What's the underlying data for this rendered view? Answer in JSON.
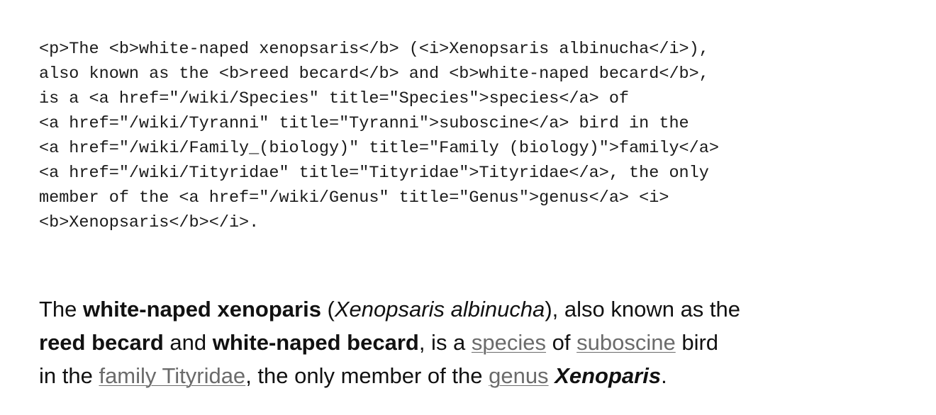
{
  "source_html": {
    "lines": [
      "<p>The <b>white-naped xenopsaris</b> (<i>Xenopsaris albinucha</i>),",
      "also known as the <b>reed becard</b> and <b>white-naped becard</b>,",
      "is a <a href=\"/wiki/Species\" title=\"Species\">species</a> of",
      "<a href=\"/wiki/Tyranni\" title=\"Tyranni\">suboscine</a> bird in the",
      "<a href=\"/wiki/Family_(biology)\" title=\"Family (biology)\">family</a>",
      "<a href=\"/wiki/Tityridae\" title=\"Tityridae\">Tityridae</a>, the only",
      "member of the <a href=\"/wiki/Genus\" title=\"Genus\">genus</a> <i>",
      "<b>Xenopsaris</b></i>."
    ]
  },
  "rendered": {
    "line1": {
      "t1": "The ",
      "b1": "white-naped xenoparis",
      "t2": " (",
      "i1": "Xenopsaris albinucha",
      "t3": "), also known as the"
    },
    "line2": {
      "b1": "reed becard",
      "t1": " and ",
      "b2": "white-naped becard",
      "t2": ", is a ",
      "link_species": "species",
      "t3": " of ",
      "link_suboscine": "suboscine",
      "t4": " bird"
    },
    "line3": {
      "t1": "in the ",
      "link_family": "family Tityridae",
      "t2": ", the only member of the ",
      "link_genus": "genus",
      "t3": " ",
      "bi1": "Xenoparis",
      "t4": "."
    }
  }
}
